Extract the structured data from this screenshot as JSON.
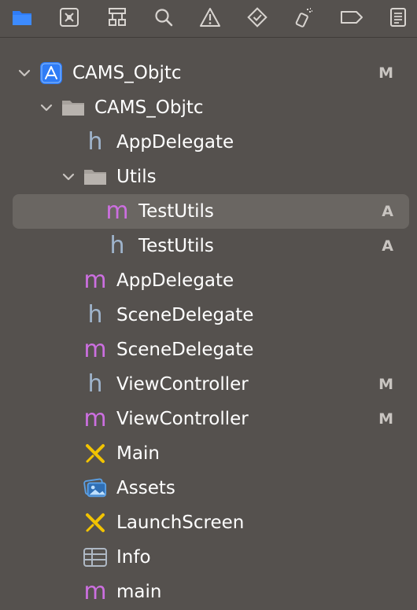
{
  "toolbar": {
    "icons": [
      "folder-icon",
      "source-control-icon",
      "hierarchy-icon",
      "search-icon",
      "warning-icon",
      "test-diamond-icon",
      "debug-spray-icon",
      "breakpoint-tag-icon",
      "report-list-icon"
    ]
  },
  "colors": {
    "accent": "#2f7cf6",
    "header_glyph": "#9fb4cc",
    "impl_glyph": "#cc6fe0",
    "xib_glyph": "#f2c300",
    "badge": "#c9c5c1"
  },
  "tree": {
    "project": {
      "label": "CAMS_Objtc",
      "badge": "M"
    },
    "group": {
      "label": "CAMS_Objtc"
    },
    "items": [
      {
        "label": "AppDelegate",
        "glyph": "h",
        "badge": ""
      },
      {
        "label": "Utils",
        "glyph": "folder",
        "badge": ""
      },
      {
        "label": "TestUtils",
        "glyph": "m",
        "badge": "A"
      },
      {
        "label": "TestUtils",
        "glyph": "h",
        "badge": "A"
      },
      {
        "label": "AppDelegate",
        "glyph": "m",
        "badge": ""
      },
      {
        "label": "SceneDelegate",
        "glyph": "h",
        "badge": ""
      },
      {
        "label": "SceneDelegate",
        "glyph": "m",
        "badge": ""
      },
      {
        "label": "ViewController",
        "glyph": "h",
        "badge": "M"
      },
      {
        "label": "ViewController",
        "glyph": "m",
        "badge": "M"
      },
      {
        "label": "Main",
        "glyph": "storyboard",
        "badge": ""
      },
      {
        "label": "Assets",
        "glyph": "assets",
        "badge": ""
      },
      {
        "label": "LaunchScreen",
        "glyph": "storyboard",
        "badge": ""
      },
      {
        "label": "Info",
        "glyph": "plist",
        "badge": ""
      },
      {
        "label": "main",
        "glyph": "m",
        "badge": ""
      }
    ],
    "h_glyph": "h",
    "m_glyph": "m"
  }
}
